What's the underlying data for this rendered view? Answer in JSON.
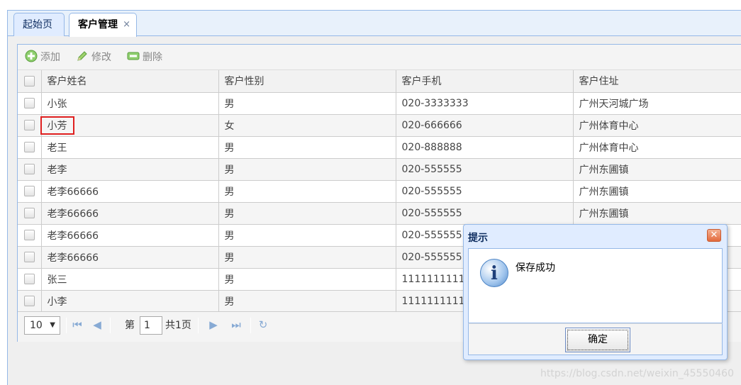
{
  "tabs": [
    {
      "label": "起始页"
    },
    {
      "label": "客户管理",
      "close": "×"
    }
  ],
  "toolbar": {
    "add": "添加",
    "edit": "修改",
    "delete": "删除"
  },
  "table": {
    "headers": [
      "客户姓名",
      "客户性别",
      "客户手机",
      "客户住址"
    ],
    "rows": [
      [
        "小张",
        "男",
        "020-3333333",
        "广州天河城广场"
      ],
      [
        "小芳",
        "女",
        "020-666666",
        "广州体育中心"
      ],
      [
        "老王",
        "男",
        "020-888888",
        "广州体育中心"
      ],
      [
        "老李",
        "男",
        "020-555555",
        "广州东圃镇"
      ],
      [
        "老李66666",
        "男",
        "020-555555",
        "广州东圃镇"
      ],
      [
        "老李66666",
        "男",
        "020-555555",
        "广州东圃镇"
      ],
      [
        "老李66666",
        "男",
        "020-555555",
        ""
      ],
      [
        "老李66666",
        "男",
        "020-555555",
        ""
      ],
      [
        "张三",
        "男",
        "1111111111",
        ""
      ],
      [
        "小李",
        "男",
        "1111111111",
        ""
      ]
    ]
  },
  "pager": {
    "page_size": "10",
    "page_label_before": "第",
    "page_value": "1",
    "page_label_after": "共1页"
  },
  "dialog": {
    "title": "提示",
    "message": "保存成功",
    "ok": "确定",
    "close": "✕"
  },
  "watermark": "https://blog.csdn.net/weixin_45550460"
}
